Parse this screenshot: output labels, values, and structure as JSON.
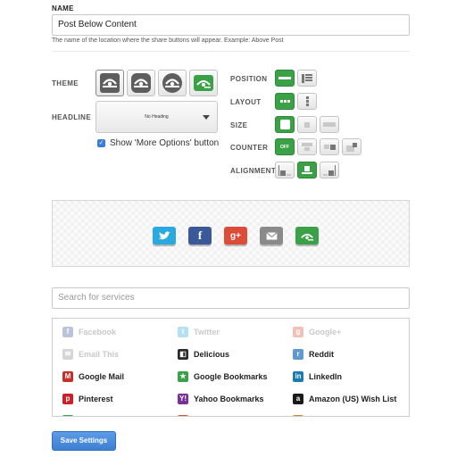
{
  "name_field": {
    "label": "NAME",
    "value": "Post Below Content",
    "help": "The name of the location where the share buttons will appear. Example: Above Post"
  },
  "theme": {
    "label": "THEME"
  },
  "headline": {
    "label": "HEADLINE",
    "value": "No Heading"
  },
  "more_options": {
    "label": "Show 'More Options' button",
    "checked": true
  },
  "position": {
    "label": "POSITION"
  },
  "layout": {
    "label": "LAYOUT"
  },
  "size": {
    "label": "SIZE"
  },
  "counter": {
    "label": "COUNTER",
    "off_label": "OFF"
  },
  "alignment": {
    "label": "ALIGNMENT"
  },
  "preview": {
    "google_plus": "g+"
  },
  "search": {
    "placeholder": "Search for services"
  },
  "services": [
    {
      "label": "Facebook",
      "icon": "facebook-icon",
      "color": "#3b5998",
      "glyph": "f",
      "enabled": false
    },
    {
      "label": "Twitter",
      "icon": "twitter-icon",
      "color": "#2aa9e0",
      "glyph": "t",
      "enabled": false
    },
    {
      "label": "Google+",
      "icon": "google-plus-icon",
      "color": "#dd4b39",
      "glyph": "g",
      "enabled": false
    },
    {
      "label": "Email This",
      "icon": "email-icon",
      "color": "#888888",
      "glyph": "✉",
      "enabled": false
    },
    {
      "label": "Delicious",
      "icon": "delicious-icon",
      "color": "#2a2a2a",
      "glyph": "◧",
      "enabled": true
    },
    {
      "label": "Reddit",
      "icon": "reddit-icon",
      "color": "#5f99cf",
      "glyph": "r",
      "enabled": true
    },
    {
      "label": "Google Mail",
      "icon": "gmail-icon",
      "color": "#c5312a",
      "glyph": "M",
      "enabled": true
    },
    {
      "label": "Google Bookmarks",
      "icon": "google-bookmarks-icon",
      "color": "#3ba146",
      "glyph": "★",
      "enabled": true
    },
    {
      "label": "LinkedIn",
      "icon": "linkedin-icon",
      "color": "#1a7bb5",
      "glyph": "in",
      "enabled": true
    },
    {
      "label": "Pinterest",
      "icon": "pinterest-icon",
      "color": "#cb2027",
      "glyph": "p",
      "enabled": true
    },
    {
      "label": "Yahoo Bookmarks",
      "icon": "yahoo-bookmarks-icon",
      "color": "#7b2f9e",
      "glyph": "Y!",
      "enabled": true
    },
    {
      "label": "Amazon (US) Wish List",
      "icon": "amazon-icon",
      "color": "#1a1a1a",
      "glyph": "a",
      "enabled": true
    }
  ],
  "save_button": {
    "label": "Save Settings"
  },
  "colors": {
    "accent_green": "#3ba146",
    "accent_blue": "#3e7fd3"
  }
}
